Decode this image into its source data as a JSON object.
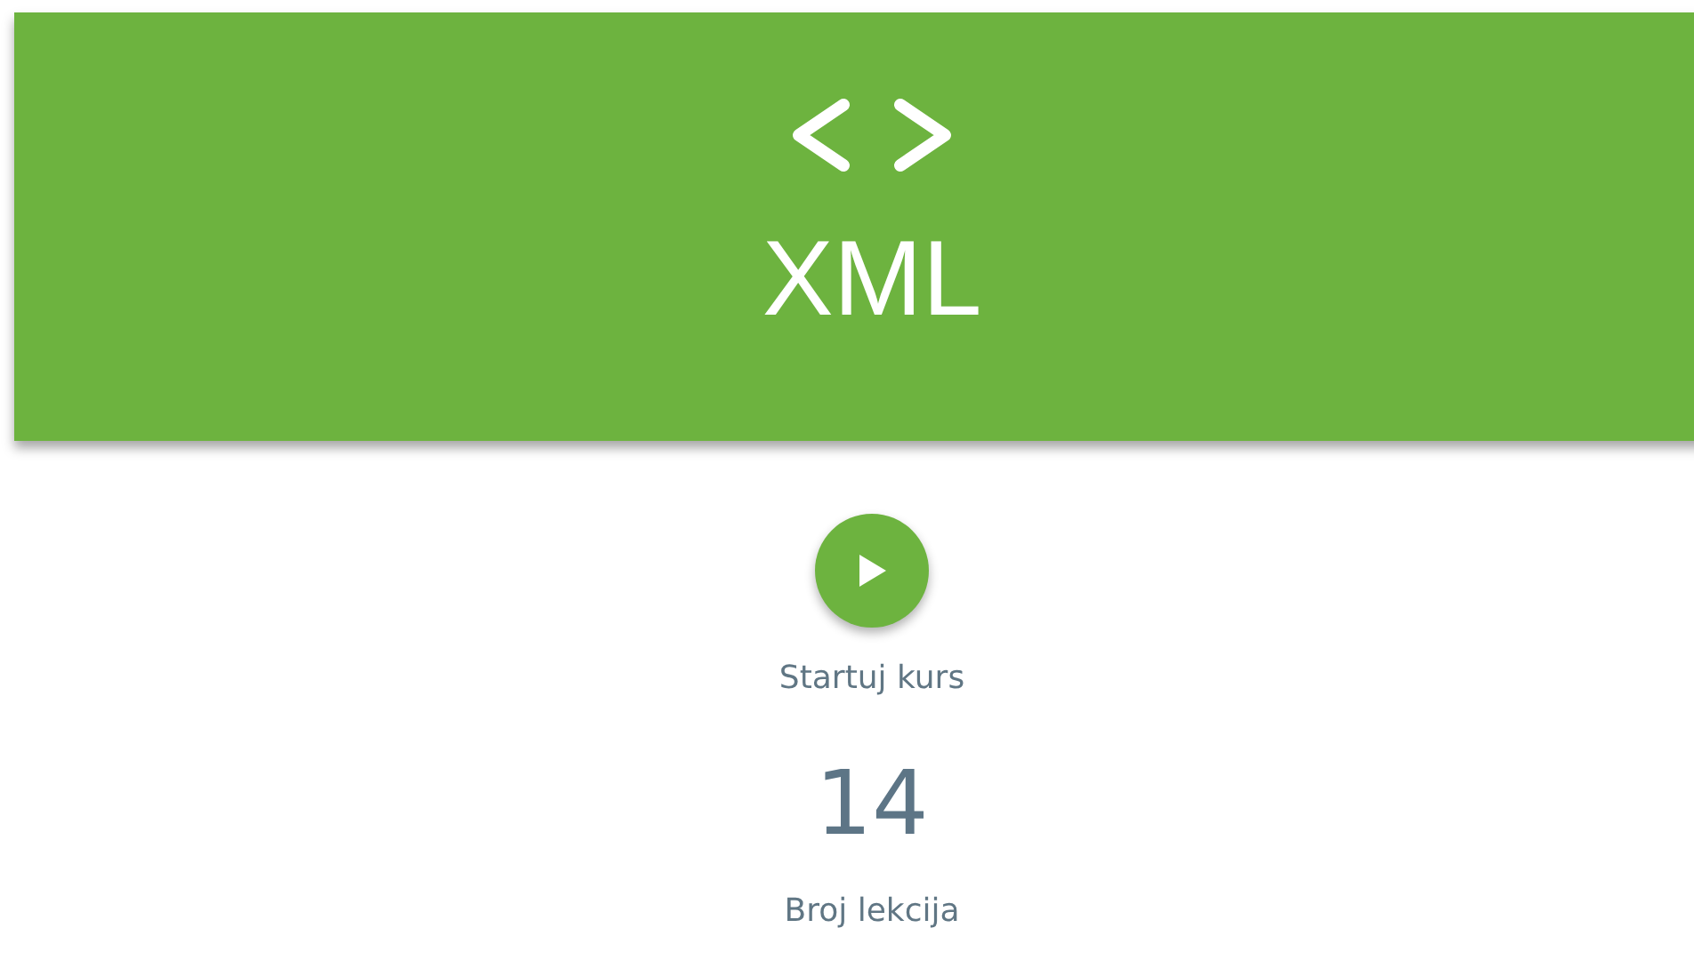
{
  "banner": {
    "title": "XML"
  },
  "start": {
    "label": "Startuj kurs"
  },
  "stats": [
    {
      "value": "14",
      "label": "Broj lekcija"
    }
  ]
}
